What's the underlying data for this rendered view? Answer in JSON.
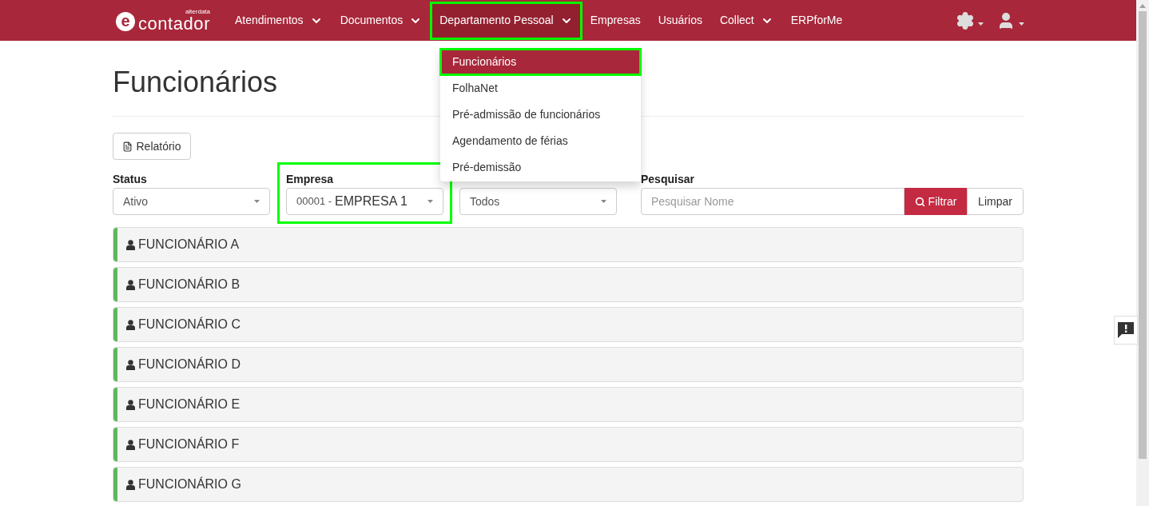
{
  "navbar": {
    "logo": {
      "mark": "e",
      "name": "contador",
      "brand": "alterdata"
    },
    "items": [
      {
        "label": "Atendimentos",
        "dropdown": true,
        "selected": false,
        "highlighted": false
      },
      {
        "label": "Documentos",
        "dropdown": true,
        "selected": false,
        "highlighted": false
      },
      {
        "label": "Departamento Pessoal",
        "dropdown": true,
        "selected": true,
        "highlighted": true
      },
      {
        "label": "Empresas",
        "dropdown": false,
        "selected": false,
        "highlighted": false
      },
      {
        "label": "Usuários",
        "dropdown": false,
        "selected": false,
        "highlighted": false
      },
      {
        "label": "Collect",
        "dropdown": true,
        "selected": false,
        "highlighted": false
      },
      {
        "label": "ERPforMe",
        "dropdown": false,
        "selected": false,
        "highlighted": false
      }
    ]
  },
  "dropdown_menu": [
    {
      "label": "Funcionários",
      "selected": true,
      "highlighted": true
    },
    {
      "label": "FolhaNet",
      "selected": false,
      "highlighted": false
    },
    {
      "label": "Pré-admissão de funcionários",
      "selected": false,
      "highlighted": false
    },
    {
      "label": "Agendamento de férias",
      "selected": false,
      "highlighted": false
    },
    {
      "label": "Pré-demissão",
      "selected": false,
      "highlighted": false
    }
  ],
  "page_title": "Funcionários",
  "report_button": "Relatório",
  "filters": [
    {
      "label": "Status",
      "value": "Ativo"
    },
    {
      "label": "Empresa",
      "code": "00001 -",
      "value": "EMPRESA 1",
      "highlighted": true
    },
    {
      "value": "Todos"
    }
  ],
  "search": {
    "label": "Pesquisar",
    "placeholder": "Pesquisar Nome",
    "filter_button": "Filtrar",
    "clear_button": "Limpar"
  },
  "employees": [
    {
      "name": "FUNCIONÁRIO A",
      "color": "#5cb85c"
    },
    {
      "name": "FUNCIONÁRIO B",
      "color": "#5cb85c"
    },
    {
      "name": "FUNCIONÁRIO C",
      "color": "#5cb85c"
    },
    {
      "name": "FUNCIONÁRIO D",
      "color": "#5cb85c"
    },
    {
      "name": "FUNCIONÁRIO E",
      "color": "#5cb85c"
    },
    {
      "name": "FUNCIONÁRIO F",
      "color": "#5cb85c"
    },
    {
      "name": "FUNCIONÁRIO G",
      "color": "#5cb85c"
    }
  ]
}
